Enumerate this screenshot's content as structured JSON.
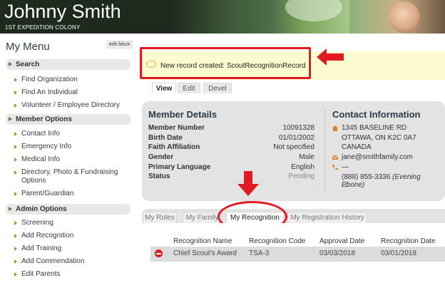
{
  "header": {
    "name": "Johnny Smith",
    "unit": "1ST EXPEDITION COLONY"
  },
  "sidebar": {
    "title": "My Menu",
    "edit_block": "edit block",
    "sections": [
      {
        "label": "Search",
        "items": [
          "Find Organization",
          "Find An Individual",
          "Volunteer / Employee Directory"
        ]
      },
      {
        "label": "Member Options",
        "items": [
          "Contact Info",
          "Emergency Info",
          "Medical Info",
          "Directory, Photo & Fundraising Options",
          "Parent/Guardian"
        ]
      },
      {
        "label": "Admin Options",
        "items": [
          "Screening",
          "Add Recognition",
          "Add Training",
          "Add Commendation",
          "Edit Parents"
        ]
      }
    ]
  },
  "notice": {
    "message": "New record created: ScoutRecognitionRecord"
  },
  "tabs": [
    "View",
    "Edit",
    "Devel"
  ],
  "member": {
    "heading": "Member Details",
    "fields": [
      {
        "label": "Member Number",
        "value": "10091328"
      },
      {
        "label": "Birth Date",
        "value": "01/01/2002"
      },
      {
        "label": "Faith Affiliation",
        "value": "Not specified"
      },
      {
        "label": "Gender",
        "value": "Male"
      },
      {
        "label": "Primary Language",
        "value": "English"
      },
      {
        "label": "Status",
        "value": "Pending"
      }
    ]
  },
  "contact": {
    "heading": "Contact Information",
    "address": [
      "1345 BASELINE RD",
      "OTTAWA, ON K2C 0A7",
      "CANADA"
    ],
    "email": "jane@smithfamily.com",
    "phone_dash": "—",
    "phone": "(888) 855-3336",
    "phone_type": "(Evening Phone)",
    "trailing_dash": "—"
  },
  "bottom_tabs": [
    "My Roles",
    "My Family",
    "My Recognition",
    "My Registration History"
  ],
  "table": {
    "columns": [
      "Recognition Name",
      "Recognition Code",
      "Approval Date",
      "Recognition Date"
    ],
    "rows": [
      {
        "name": "Chief Scout's Award",
        "code": "TSA-3",
        "approval": "03/03/2018",
        "date": "03/01/2018"
      }
    ]
  },
  "colors": {
    "accent_red": "#e01b24",
    "card_bg": "#e3e3e3",
    "notice_bg": "#fbfbcf"
  }
}
